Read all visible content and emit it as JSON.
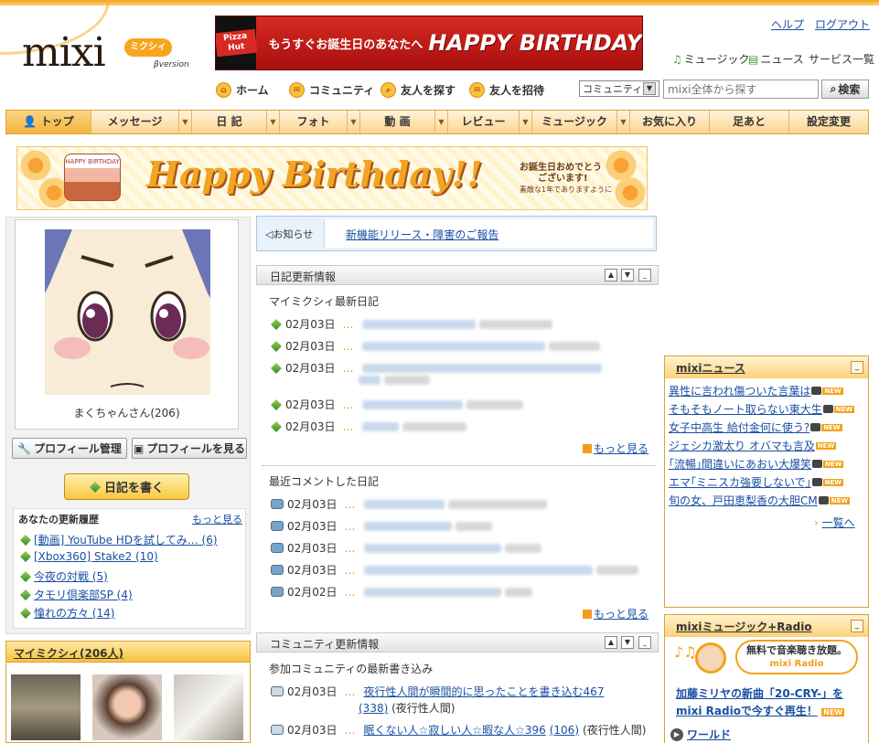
{
  "header": {
    "logo": "mixi",
    "logo_kana": "ミクシィ",
    "logo_beta": "βversion",
    "help": "ヘルプ",
    "logout": "ログアウト",
    "services": [
      "ミュージック",
      "ニュース",
      "サービス一覧"
    ],
    "banner_brand": "Pizza Hut",
    "banner_sub": "もうすぐお誕生日のあなたへ",
    "banner_main": "HAPPY BIRTHDAY"
  },
  "subnav": {
    "home": "ホーム",
    "community": "コミュニティ",
    "find_friend": "友人を探す",
    "invite_friend": "友人を招待",
    "scope": "コミュニティ",
    "search_placeholder": "mixi全体から探す",
    "search_button": "検索"
  },
  "tabs": [
    "トップ",
    "メッセージ",
    "日 記",
    "フォト",
    "動 画",
    "レビュー",
    "ミュージック",
    "お気に入り",
    "足あと",
    "設定変更"
  ],
  "birthday": {
    "cake_text": "HAPPY BIRTHDAY",
    "title": "Happy Birthday!!",
    "message_1": "お誕生日おめでとう",
    "message_2": "ございます!",
    "message_3": "素敵な1年でありますように"
  },
  "profile": {
    "name": "まくちゃんさん(206)",
    "edit_button": "プロフィール管理",
    "view_button": "プロフィールを見る",
    "write_diary": "日記を書く"
  },
  "history": {
    "title": "あなたの更新履歴",
    "more": "もっと見る",
    "items": [
      "[動画] YouTube HDを試してみ… (6)",
      "[Xbox360] Stake2 (10)",
      "今夜の対戦 (5)",
      "タモリ倶楽部SP (4)",
      "憧れの方々 (14)"
    ]
  },
  "friends": {
    "title": "マイミクシィ(206人)"
  },
  "notice": {
    "label": "お知らせ",
    "link": "新機能リリース・障害のご報告"
  },
  "diary": {
    "title": "日記更新情報",
    "subtitle": "マイミクシィ最新日記",
    "dates": [
      "02月03日",
      "02月03日",
      "02月03日",
      "02月03日",
      "02月03日"
    ],
    "more": "もっと見る"
  },
  "comments": {
    "subtitle": "最近コメントした日記",
    "dates": [
      "02月03日",
      "02月03日",
      "02月03日",
      "02月03日",
      "02月02日"
    ],
    "more": "もっと見る"
  },
  "community": {
    "title": "コミュニティ更新情報",
    "subtitle": "参加コミュニティの最新書き込み",
    "items": [
      {
        "date": "02月03日",
        "link": "夜行性人間が瞬間的に思ったことを書き込む467",
        "count": "(338)",
        "comm": "(夜行性人間)"
      },
      {
        "date": "02月03日",
        "link": "眠くない人☆寂しい人☆暇な人☆396",
        "count": "(106)",
        "comm": "(夜行性人間)"
      }
    ]
  },
  "news": {
    "title": "mixiニュース",
    "items": [
      "異性に言われ傷ついた言葉は",
      "そもそもノート取らない東大生",
      "女子中高生 給付金何に使う?",
      "ジェシカ激太り オバマも言及",
      "｢流暢｣間違いにあおい大爆笑",
      "エマ｢ミニスカ強要しないで｣",
      "旬の女、戸田恵梨香の大胆CM"
    ],
    "new_badge": "NEW",
    "more": "一覧へ"
  },
  "radio": {
    "title": "mixiミュージック+Radio",
    "bubble": "無料で音楽聴き放題。",
    "bubble_sub": "mixi Radio",
    "headline_1": "加藤ミリヤの新曲「20-CRY-」を",
    "headline_2": "mixi Radioで今すぐ再生！",
    "world": "ワールド"
  },
  "colors": {
    "accent": "#f7a51e",
    "link": "#1a4fa3",
    "tab_bg": "#fbd58e"
  }
}
